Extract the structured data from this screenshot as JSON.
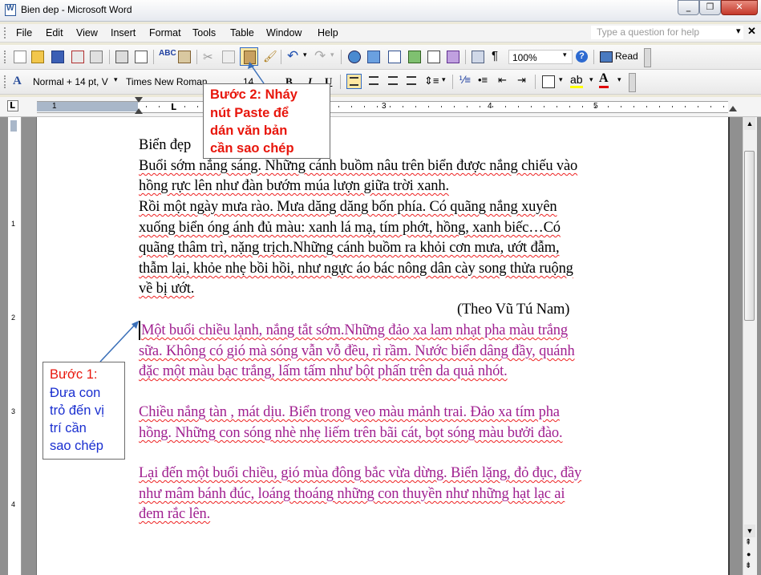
{
  "window": {
    "title": "Bien dep - Microsoft Word"
  },
  "menu": {
    "items": [
      "File",
      "Edit",
      "View",
      "Insert",
      "Format",
      "Tools",
      "Table",
      "Window",
      "Help"
    ],
    "help_placeholder": "Type a question for help"
  },
  "toolbar": {
    "zoom": "100%",
    "read_label": "Read"
  },
  "formatting": {
    "style": "Normal + 14 pt, V",
    "font": "Times New Roman",
    "size": "14",
    "bold": "B",
    "italic": "I",
    "underline": "U"
  },
  "ruler": {
    "numbers": [
      "1",
      "1",
      "2",
      "3",
      "4",
      "5"
    ],
    "vnumbers": [
      "1",
      "2",
      "3",
      "4"
    ]
  },
  "document": {
    "original_lines": [
      "Biển đẹp",
      "Buổi sớm nắng sáng. Những cánh buồm nâu trên biển được nắng chiếu vào",
      "hồng rực lên như đàn bướm múa lượn giữa trời xanh.",
      "Rồi một ngày mưa rào. Mưa dăng dăng bốn phía. Có quãng nắng xuyên",
      "xuống biển óng ánh đủ màu: xanh lá mạ, tím phớt, hồng, xanh biếc…Có",
      "quãng thâm trì, nặng trịch.Những cánh buồm ra khỏi cơn mưa, ướt đẫm,",
      "thẫm lại, khỏe nhẹ bồi hồi, như ngực áo bác nông dân cày song thửa ruộng",
      "về bị ướt."
    ],
    "author": "(Theo Vũ Tú Nam)",
    "pasted_lines": [
      "Một buổi chiều lạnh, nắng tắt sớm.Những đảo xa lam nhạt pha màu trắng",
      "sữa. Không có gió mà sóng vẫn vỗ đều, rì rầm. Nước biển dâng đầy, quánh",
      "đặc một màu bạc trắng, lấm tấm như bột phấn trên da quả nhót.",
      "",
      "Chiều nắng tàn , mát dịu. Biển trong veo màu mảnh trai. Đảo xa tím pha",
      "hồng. Những con sóng nhè nhẹ liếm trên bãi cát, bọt sóng màu bưởi đào.",
      "",
      "Lại đến một buổi chiều, gió mùa đông bắc vừa dừng. Biển lặng, đỏ đục, đầy",
      "như mâm bánh đúc, loáng thoáng những con thuyền như những hạt lạc ai",
      "đem rắc lên."
    ]
  },
  "callouts": {
    "step2": {
      "lines": [
        "Bước 2: Nháy",
        "nút Paste để",
        "dán văn bản",
        "cần sao chép"
      ]
    },
    "step1": {
      "lines": [
        "Bước 1:",
        "Đưa con",
        "trỏ đến vị",
        "trí cần",
        "sao chép"
      ]
    }
  },
  "colors": {
    "accent_red": "#e8160c",
    "callout_blue": "#1a2fd0",
    "pasted_text": "#a02090",
    "arrow": "#3a6fb8"
  }
}
